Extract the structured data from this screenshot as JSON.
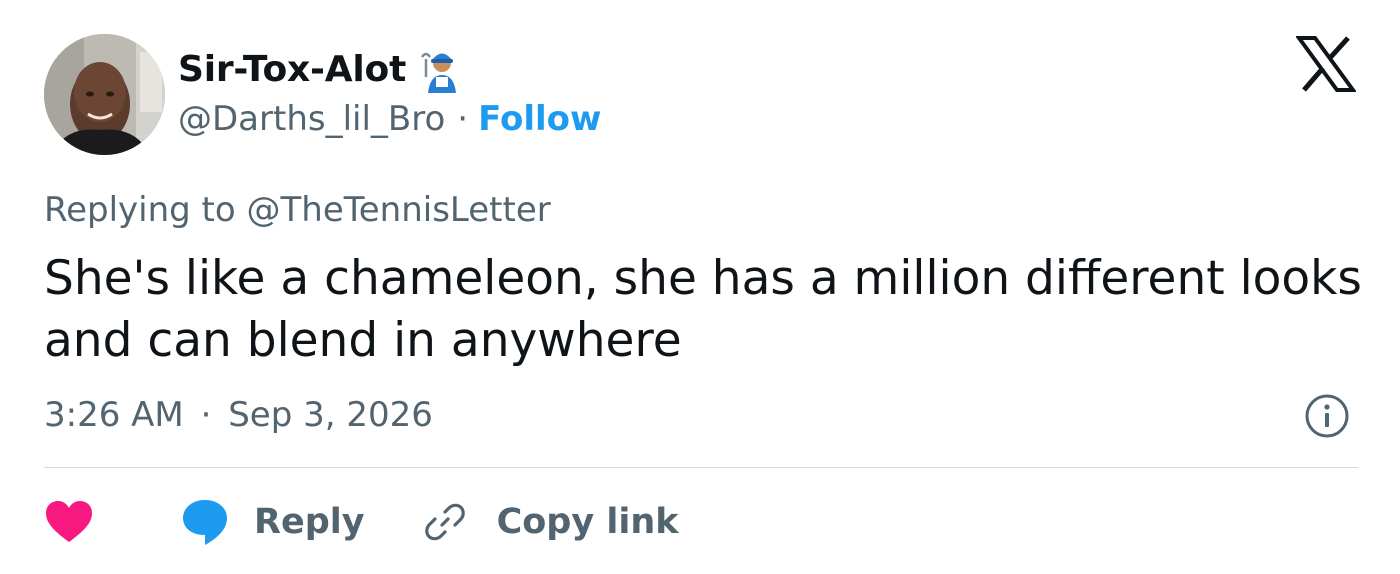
{
  "tweet": {
    "author": {
      "display_name": "Sir-Tox-Alot",
      "handle": "@Darths_lil_Bro",
      "follow_label": "Follow",
      "name_emoji": "mechanic-emoji"
    },
    "separator": "·",
    "replying_prefix": "Replying to",
    "replying_to": "@TheTennisLetter",
    "text": "She's like a chameleon, she has a million different looks and can blend in anywhere",
    "time": "3:26 AM",
    "date": "Sep 3, 2026",
    "actions": {
      "like_icon": "heart-icon",
      "reply_label": "Reply",
      "reply_icon": "speech-bubble-icon",
      "copy_label": "Copy link",
      "copy_icon": "link-icon"
    },
    "brand": "x-logo-icon"
  },
  "colors": {
    "accent": "#1d9bf0",
    "text": "#0f1419",
    "secondary": "#536471",
    "heart": "#f91880",
    "divider": "#cfd9de"
  }
}
